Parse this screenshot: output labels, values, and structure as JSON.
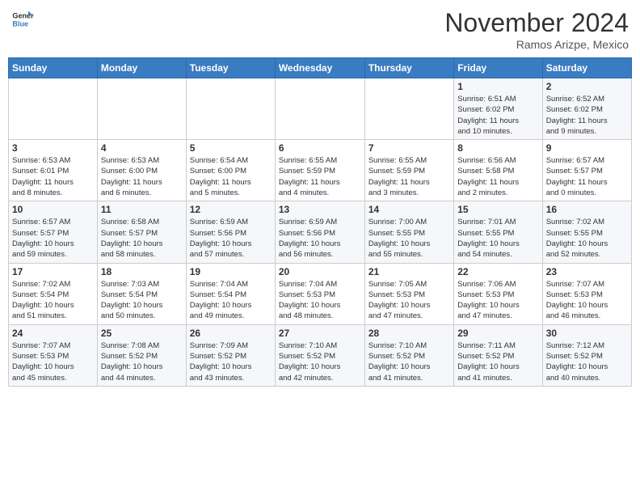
{
  "header": {
    "logo_general": "General",
    "logo_blue": "Blue",
    "month_title": "November 2024",
    "location": "Ramos Arizpe, Mexico"
  },
  "days_of_week": [
    "Sunday",
    "Monday",
    "Tuesday",
    "Wednesday",
    "Thursday",
    "Friday",
    "Saturday"
  ],
  "weeks": [
    [
      {
        "day": "",
        "info": ""
      },
      {
        "day": "",
        "info": ""
      },
      {
        "day": "",
        "info": ""
      },
      {
        "day": "",
        "info": ""
      },
      {
        "day": "",
        "info": ""
      },
      {
        "day": "1",
        "info": "Sunrise: 6:51 AM\nSunset: 6:02 PM\nDaylight: 11 hours\nand 10 minutes."
      },
      {
        "day": "2",
        "info": "Sunrise: 6:52 AM\nSunset: 6:02 PM\nDaylight: 11 hours\nand 9 minutes."
      }
    ],
    [
      {
        "day": "3",
        "info": "Sunrise: 6:53 AM\nSunset: 6:01 PM\nDaylight: 11 hours\nand 8 minutes."
      },
      {
        "day": "4",
        "info": "Sunrise: 6:53 AM\nSunset: 6:00 PM\nDaylight: 11 hours\nand 6 minutes."
      },
      {
        "day": "5",
        "info": "Sunrise: 6:54 AM\nSunset: 6:00 PM\nDaylight: 11 hours\nand 5 minutes."
      },
      {
        "day": "6",
        "info": "Sunrise: 6:55 AM\nSunset: 5:59 PM\nDaylight: 11 hours\nand 4 minutes."
      },
      {
        "day": "7",
        "info": "Sunrise: 6:55 AM\nSunset: 5:59 PM\nDaylight: 11 hours\nand 3 minutes."
      },
      {
        "day": "8",
        "info": "Sunrise: 6:56 AM\nSunset: 5:58 PM\nDaylight: 11 hours\nand 2 minutes."
      },
      {
        "day": "9",
        "info": "Sunrise: 6:57 AM\nSunset: 5:57 PM\nDaylight: 11 hours\nand 0 minutes."
      }
    ],
    [
      {
        "day": "10",
        "info": "Sunrise: 6:57 AM\nSunset: 5:57 PM\nDaylight: 10 hours\nand 59 minutes."
      },
      {
        "day": "11",
        "info": "Sunrise: 6:58 AM\nSunset: 5:57 PM\nDaylight: 10 hours\nand 58 minutes."
      },
      {
        "day": "12",
        "info": "Sunrise: 6:59 AM\nSunset: 5:56 PM\nDaylight: 10 hours\nand 57 minutes."
      },
      {
        "day": "13",
        "info": "Sunrise: 6:59 AM\nSunset: 5:56 PM\nDaylight: 10 hours\nand 56 minutes."
      },
      {
        "day": "14",
        "info": "Sunrise: 7:00 AM\nSunset: 5:55 PM\nDaylight: 10 hours\nand 55 minutes."
      },
      {
        "day": "15",
        "info": "Sunrise: 7:01 AM\nSunset: 5:55 PM\nDaylight: 10 hours\nand 54 minutes."
      },
      {
        "day": "16",
        "info": "Sunrise: 7:02 AM\nSunset: 5:55 PM\nDaylight: 10 hours\nand 52 minutes."
      }
    ],
    [
      {
        "day": "17",
        "info": "Sunrise: 7:02 AM\nSunset: 5:54 PM\nDaylight: 10 hours\nand 51 minutes."
      },
      {
        "day": "18",
        "info": "Sunrise: 7:03 AM\nSunset: 5:54 PM\nDaylight: 10 hours\nand 50 minutes."
      },
      {
        "day": "19",
        "info": "Sunrise: 7:04 AM\nSunset: 5:54 PM\nDaylight: 10 hours\nand 49 minutes."
      },
      {
        "day": "20",
        "info": "Sunrise: 7:04 AM\nSunset: 5:53 PM\nDaylight: 10 hours\nand 48 minutes."
      },
      {
        "day": "21",
        "info": "Sunrise: 7:05 AM\nSunset: 5:53 PM\nDaylight: 10 hours\nand 47 minutes."
      },
      {
        "day": "22",
        "info": "Sunrise: 7:06 AM\nSunset: 5:53 PM\nDaylight: 10 hours\nand 47 minutes."
      },
      {
        "day": "23",
        "info": "Sunrise: 7:07 AM\nSunset: 5:53 PM\nDaylight: 10 hours\nand 46 minutes."
      }
    ],
    [
      {
        "day": "24",
        "info": "Sunrise: 7:07 AM\nSunset: 5:53 PM\nDaylight: 10 hours\nand 45 minutes."
      },
      {
        "day": "25",
        "info": "Sunrise: 7:08 AM\nSunset: 5:52 PM\nDaylight: 10 hours\nand 44 minutes."
      },
      {
        "day": "26",
        "info": "Sunrise: 7:09 AM\nSunset: 5:52 PM\nDaylight: 10 hours\nand 43 minutes."
      },
      {
        "day": "27",
        "info": "Sunrise: 7:10 AM\nSunset: 5:52 PM\nDaylight: 10 hours\nand 42 minutes."
      },
      {
        "day": "28",
        "info": "Sunrise: 7:10 AM\nSunset: 5:52 PM\nDaylight: 10 hours\nand 41 minutes."
      },
      {
        "day": "29",
        "info": "Sunrise: 7:11 AM\nSunset: 5:52 PM\nDaylight: 10 hours\nand 41 minutes."
      },
      {
        "day": "30",
        "info": "Sunrise: 7:12 AM\nSunset: 5:52 PM\nDaylight: 10 hours\nand 40 minutes."
      }
    ]
  ]
}
